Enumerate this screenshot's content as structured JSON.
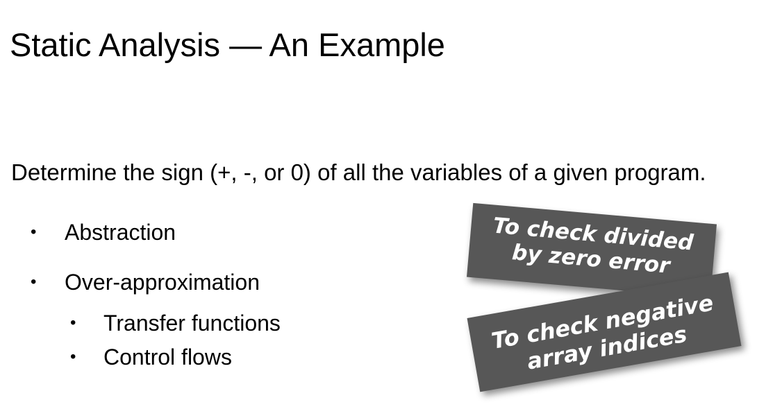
{
  "slide": {
    "title": "Static Analysis — An Example",
    "intro": "Determine the sign (+, -, or 0) of all the variables of a given program.",
    "bullets": [
      {
        "marker": "•",
        "text": "Abstraction"
      },
      {
        "marker": "•",
        "text": "Over-approximation"
      },
      {
        "marker": "•",
        "text": "Transfer functions"
      },
      {
        "marker": "•",
        "text": "Control flows"
      }
    ]
  },
  "notes": [
    {
      "lines": [
        "To check divided",
        "by zero error"
      ]
    },
    {
      "lines": [
        "To check negative",
        "array indices"
      ]
    }
  ],
  "colors": {
    "note_background": "#575757",
    "note_text": "#ffffff",
    "text": "#000000",
    "background": "#ffffff"
  }
}
